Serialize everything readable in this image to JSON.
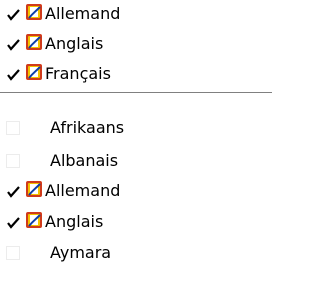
{
  "favorites": [
    {
      "label": "Allemand",
      "checked": true
    },
    {
      "label": "Anglais",
      "checked": true
    },
    {
      "label": "Français",
      "checked": true
    }
  ],
  "languages": [
    {
      "label": "Afrikaans",
      "checked": false
    },
    {
      "label": "Albanais",
      "checked": false
    },
    {
      "label": "Allemand",
      "checked": true
    },
    {
      "label": "Anglais",
      "checked": true
    },
    {
      "label": "Aymara",
      "checked": false
    }
  ],
  "icons": {
    "checkmark": "checkmark-icon",
    "language": "book-language-icon"
  },
  "colors": {
    "book_outer": "#d03a1a",
    "book_inner": "#f2c200",
    "book_page": "#ffffff",
    "book_spine": "#0b3ea8",
    "check": "#000000"
  }
}
